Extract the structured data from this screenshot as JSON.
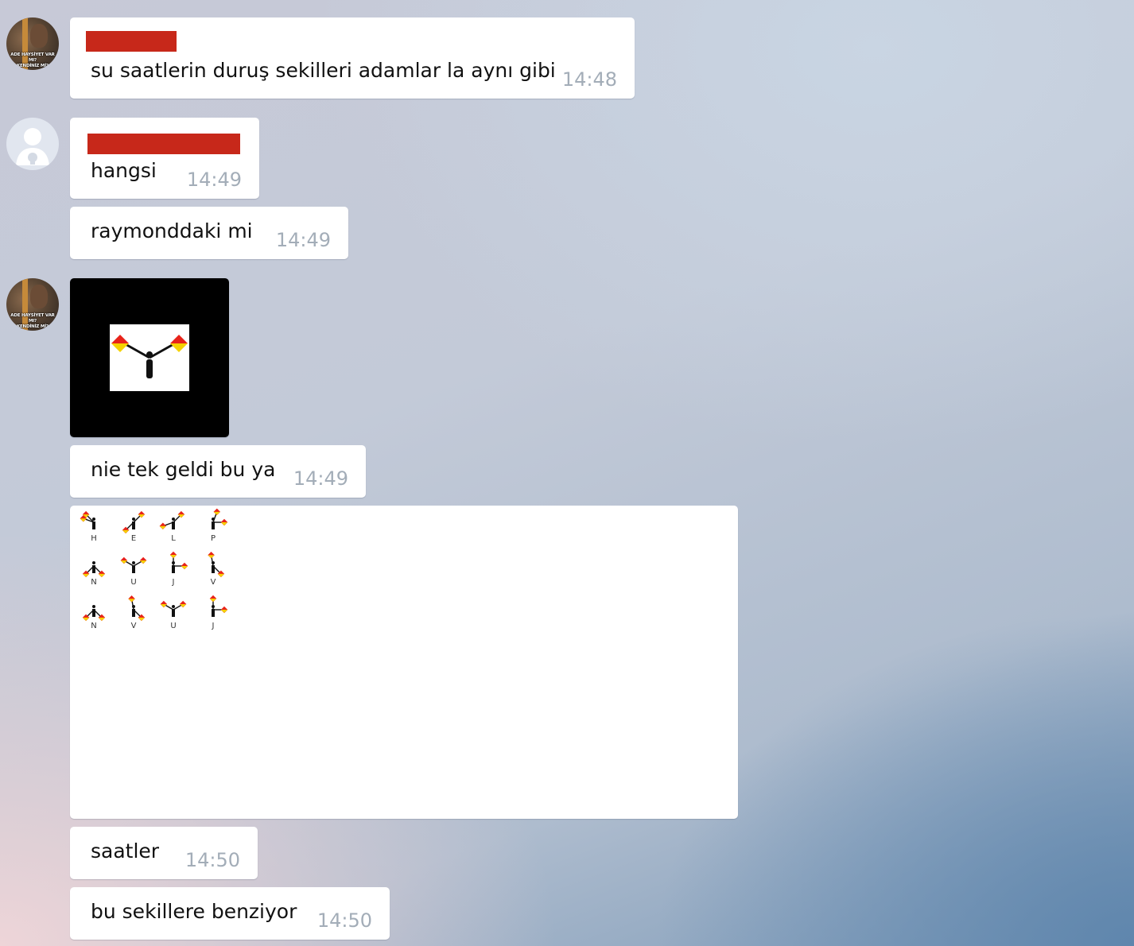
{
  "avatars": {
    "photo_caption_line1": "ADE HAYSİYET VAR MI?",
    "photo_caption_line2": "KENDİNİZ Mİ?"
  },
  "messages": [
    {
      "text": "su saatlerin duruş sekilleri adamlar la aynı gibi",
      "time": "14:48"
    },
    {
      "text": "hangsi",
      "time": "14:49"
    },
    {
      "text": "raymonddaki mi",
      "time": "14:49"
    },
    {
      "text": "nie tek geldi bu ya",
      "time": "14:49"
    },
    {
      "text": "saatler",
      "time": "14:50"
    },
    {
      "text": "bu sekillere benziyor",
      "time": "14:50"
    }
  ],
  "semaphore_image": {
    "rows": [
      [
        "H",
        "E",
        "L",
        "P"
      ],
      [
        "N",
        "U",
        "J",
        "V"
      ],
      [
        "N",
        "V",
        "U",
        "J"
      ]
    ]
  },
  "colors": {
    "bubble": "#ffffff",
    "time": "#a3adb8",
    "redaction": "#c7281a",
    "flag_red": "#e8231a",
    "flag_yellow": "#f5d200"
  }
}
